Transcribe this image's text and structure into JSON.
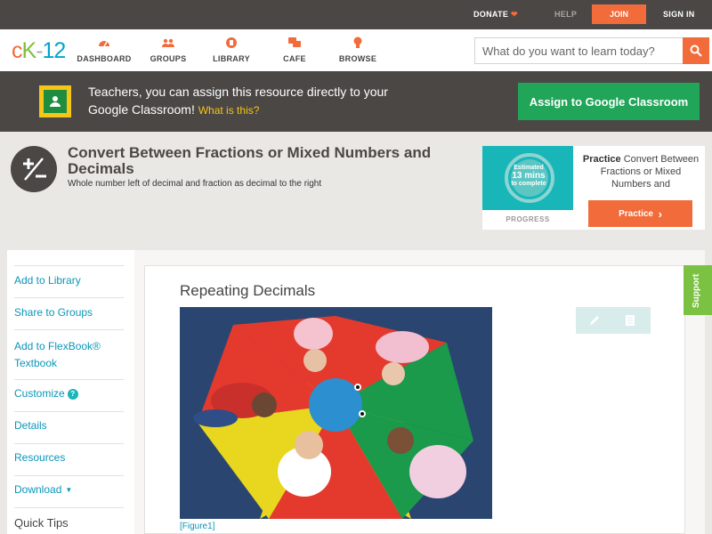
{
  "topbar": {
    "donate": "DONATE",
    "help": "HELP",
    "join": "JOIN",
    "signin": "SIGN IN"
  },
  "logo": {
    "c": "c",
    "k": "K",
    "dash": "-",
    "num": "12"
  },
  "nav": [
    {
      "label": "DASHBOARD",
      "icon": "dashboard-icon"
    },
    {
      "label": "GROUPS",
      "icon": "groups-icon"
    },
    {
      "label": "LIBRARY",
      "icon": "library-icon"
    },
    {
      "label": "CAFE",
      "icon": "cafe-icon"
    },
    {
      "label": "BROWSE",
      "icon": "browse-icon"
    }
  ],
  "search": {
    "placeholder": "What do you want to learn today?"
  },
  "banner": {
    "message": "Teachers, you can assign this resource directly to your Google Classroom!",
    "what_is": "What is this?",
    "assign_button": "Assign to Google Classroom"
  },
  "concept": {
    "title": "Convert Between Fractions or Mixed Numbers and Decimals",
    "subtitle": "Whole number left of decimal and fraction as decimal to the right"
  },
  "practice": {
    "estimated": "Estimated",
    "mins": "13 mins",
    "to_complete": "to complete",
    "progress_label": "PROGRESS",
    "heading": "Practice",
    "description": "Convert Between Fractions or Mixed Numbers and",
    "button": "Practice"
  },
  "sidebar": {
    "add_library": "Add to Library",
    "share_groups": "Share to Groups",
    "add_flexbook": "Add to FlexBook®",
    "add_flexbook_2": "Textbook",
    "customize": "Customize",
    "customize_help": "?",
    "details": "Details",
    "resources": "Resources",
    "download": "Download",
    "quick_tips": "Quick Tips"
  },
  "lesson": {
    "title": "Repeating Decimals",
    "figure_label": "[Figure1]"
  },
  "support": "Support",
  "colors": {
    "brand_orange": "#f26b3a",
    "brand_green": "#7cc242",
    "link_blue": "#0a96ba",
    "classroom_green": "#21a559",
    "teal": "#19b6b9"
  }
}
